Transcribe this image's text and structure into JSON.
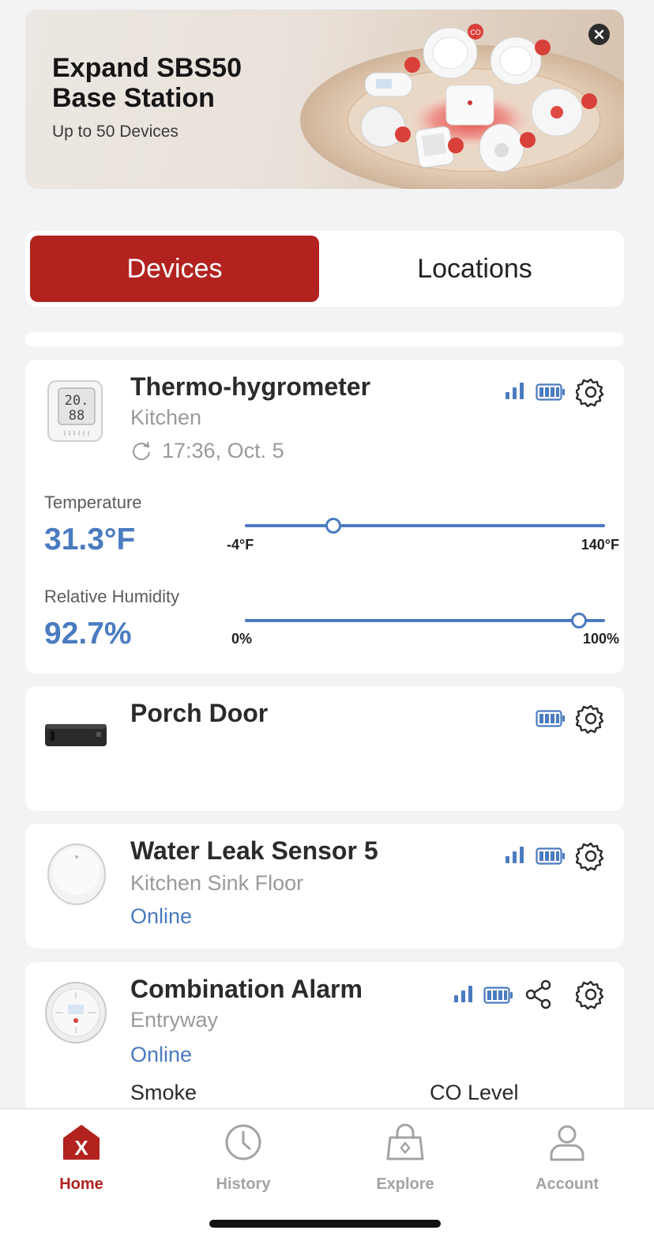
{
  "banner": {
    "title": "Expand SBS50 Base Station",
    "subtitle": "Up to 50 Devices",
    "close_icon": "close-icon",
    "product_label_co": "CO"
  },
  "tabs": [
    {
      "label": "Devices",
      "active": true
    },
    {
      "label": "Locations",
      "active": false
    }
  ],
  "accent_color": "#b2221f",
  "value_color": "#4a7bc0",
  "devices": [
    {
      "name": "Thermo-hygrometer",
      "location": "Kitchen",
      "last_update": "17:36, Oct. 5",
      "icons": [
        "signal-icon",
        "battery-icon",
        "gear-icon"
      ],
      "screen_top": "20.",
      "screen_bottom": "88",
      "metrics": [
        {
          "label": "Temperature",
          "value": "31.3°F",
          "min": "-4°F",
          "max": "140°F",
          "min_num": -4,
          "max_num": 140,
          "current": 31.3
        },
        {
          "label": "Relative Humidity",
          "value": "92.7%",
          "min": "0%",
          "max": "100%",
          "min_num": 0,
          "max_num": 100,
          "current": 92.7
        }
      ]
    },
    {
      "name": "Porch Door",
      "icons": [
        "battery-icon",
        "gear-icon"
      ]
    },
    {
      "name": "Water Leak Sensor 5",
      "location": "Kitchen Sink Floor",
      "status": "Online",
      "icons": [
        "signal-icon",
        "battery-icon",
        "gear-icon"
      ]
    },
    {
      "name": "Combination Alarm",
      "location": "Entryway",
      "status": "Online",
      "icons": [
        "signal-icon",
        "battery-icon",
        "share-icon",
        "gear-icon"
      ],
      "sub_labels": [
        "Smoke",
        "CO Level"
      ]
    }
  ],
  "nav": [
    {
      "label": "Home",
      "icon": "home-icon",
      "active": true,
      "glyph": "X"
    },
    {
      "label": "History",
      "icon": "clock-icon",
      "active": false
    },
    {
      "label": "Explore",
      "icon": "bag-icon",
      "active": false
    },
    {
      "label": "Account",
      "icon": "person-icon",
      "active": false
    }
  ]
}
